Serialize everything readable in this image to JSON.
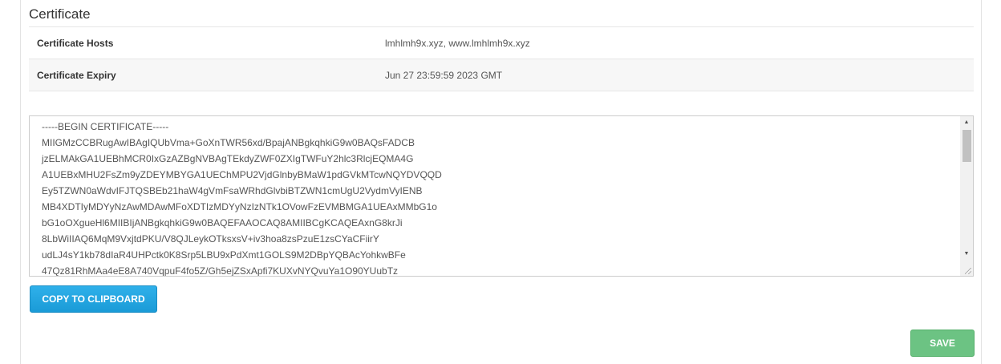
{
  "section": {
    "title": "Certificate"
  },
  "details": [
    {
      "label": "Certificate Hosts",
      "value": "lmhlmh9x.xyz, www.lmhlmh9x.xyz"
    },
    {
      "label": "Certificate Expiry",
      "value": "Jun 27 23:59:59 2023 GMT"
    }
  ],
  "certificate": {
    "text": "-----BEGIN CERTIFICATE-----\nMIIGMzCCBRugAwIBAgIQUbVma+GoXnTWR56xd/BpajANBgkqhkiG9w0BAQsFADCB\njzELMAkGA1UEBhMCR0IxGzAZBgNVBAgTEkdyZWF0ZXIgTWFuY2hlc3RlcjEQMA4G\nA1UEBxMHU2FsZm9yZDEYMBYGA1UEChMPU2VjdGlnbyBMaW1pdGVkMTcwNQYDVQQD\nEy5TZWN0aWdvIFJTQSBEb21haW4gVmFsaWRhdGlvbiBTZWN1cmUgU2VydmVyIENB\nMB4XDTIyMDYyNzAwMDAwMFoXDTIzMDYyNzIzNTk1OVowFzEVMBMGA1UEAxMMbG1o\nbG1oOXgueHl6MIIBIjANBgkqhkiG9w0BAQEFAAOCAQ8AMIIBCgKCAQEAxnG8krJi\n8LbWiIIAQ6MqM9VxjtdPKU/V8QJLeykOTksxsV+iv3hoa8zsPzuE1zsCYaCFiirY\nudLJ4sY1kb78dIaR4UHPctk0K8Srp5LBU9xPdXmt1GOLS9M2DBpYQBAcYohkwBFe\n47Qz81RhMAa4eE8A740VqpuF4fo5Z/Gh5ejZSxApfi7KUXvNYQvuYa1O90YUubTz"
  },
  "buttons": {
    "copy_label": "COPY TO CLIPBOARD",
    "save_label": "SAVE"
  },
  "icons": {
    "scroll_up": "triangle-up",
    "scroll_down": "triangle-down"
  },
  "colors": {
    "copy_button": "#1a9bd7",
    "save_button": "#6cc383"
  }
}
